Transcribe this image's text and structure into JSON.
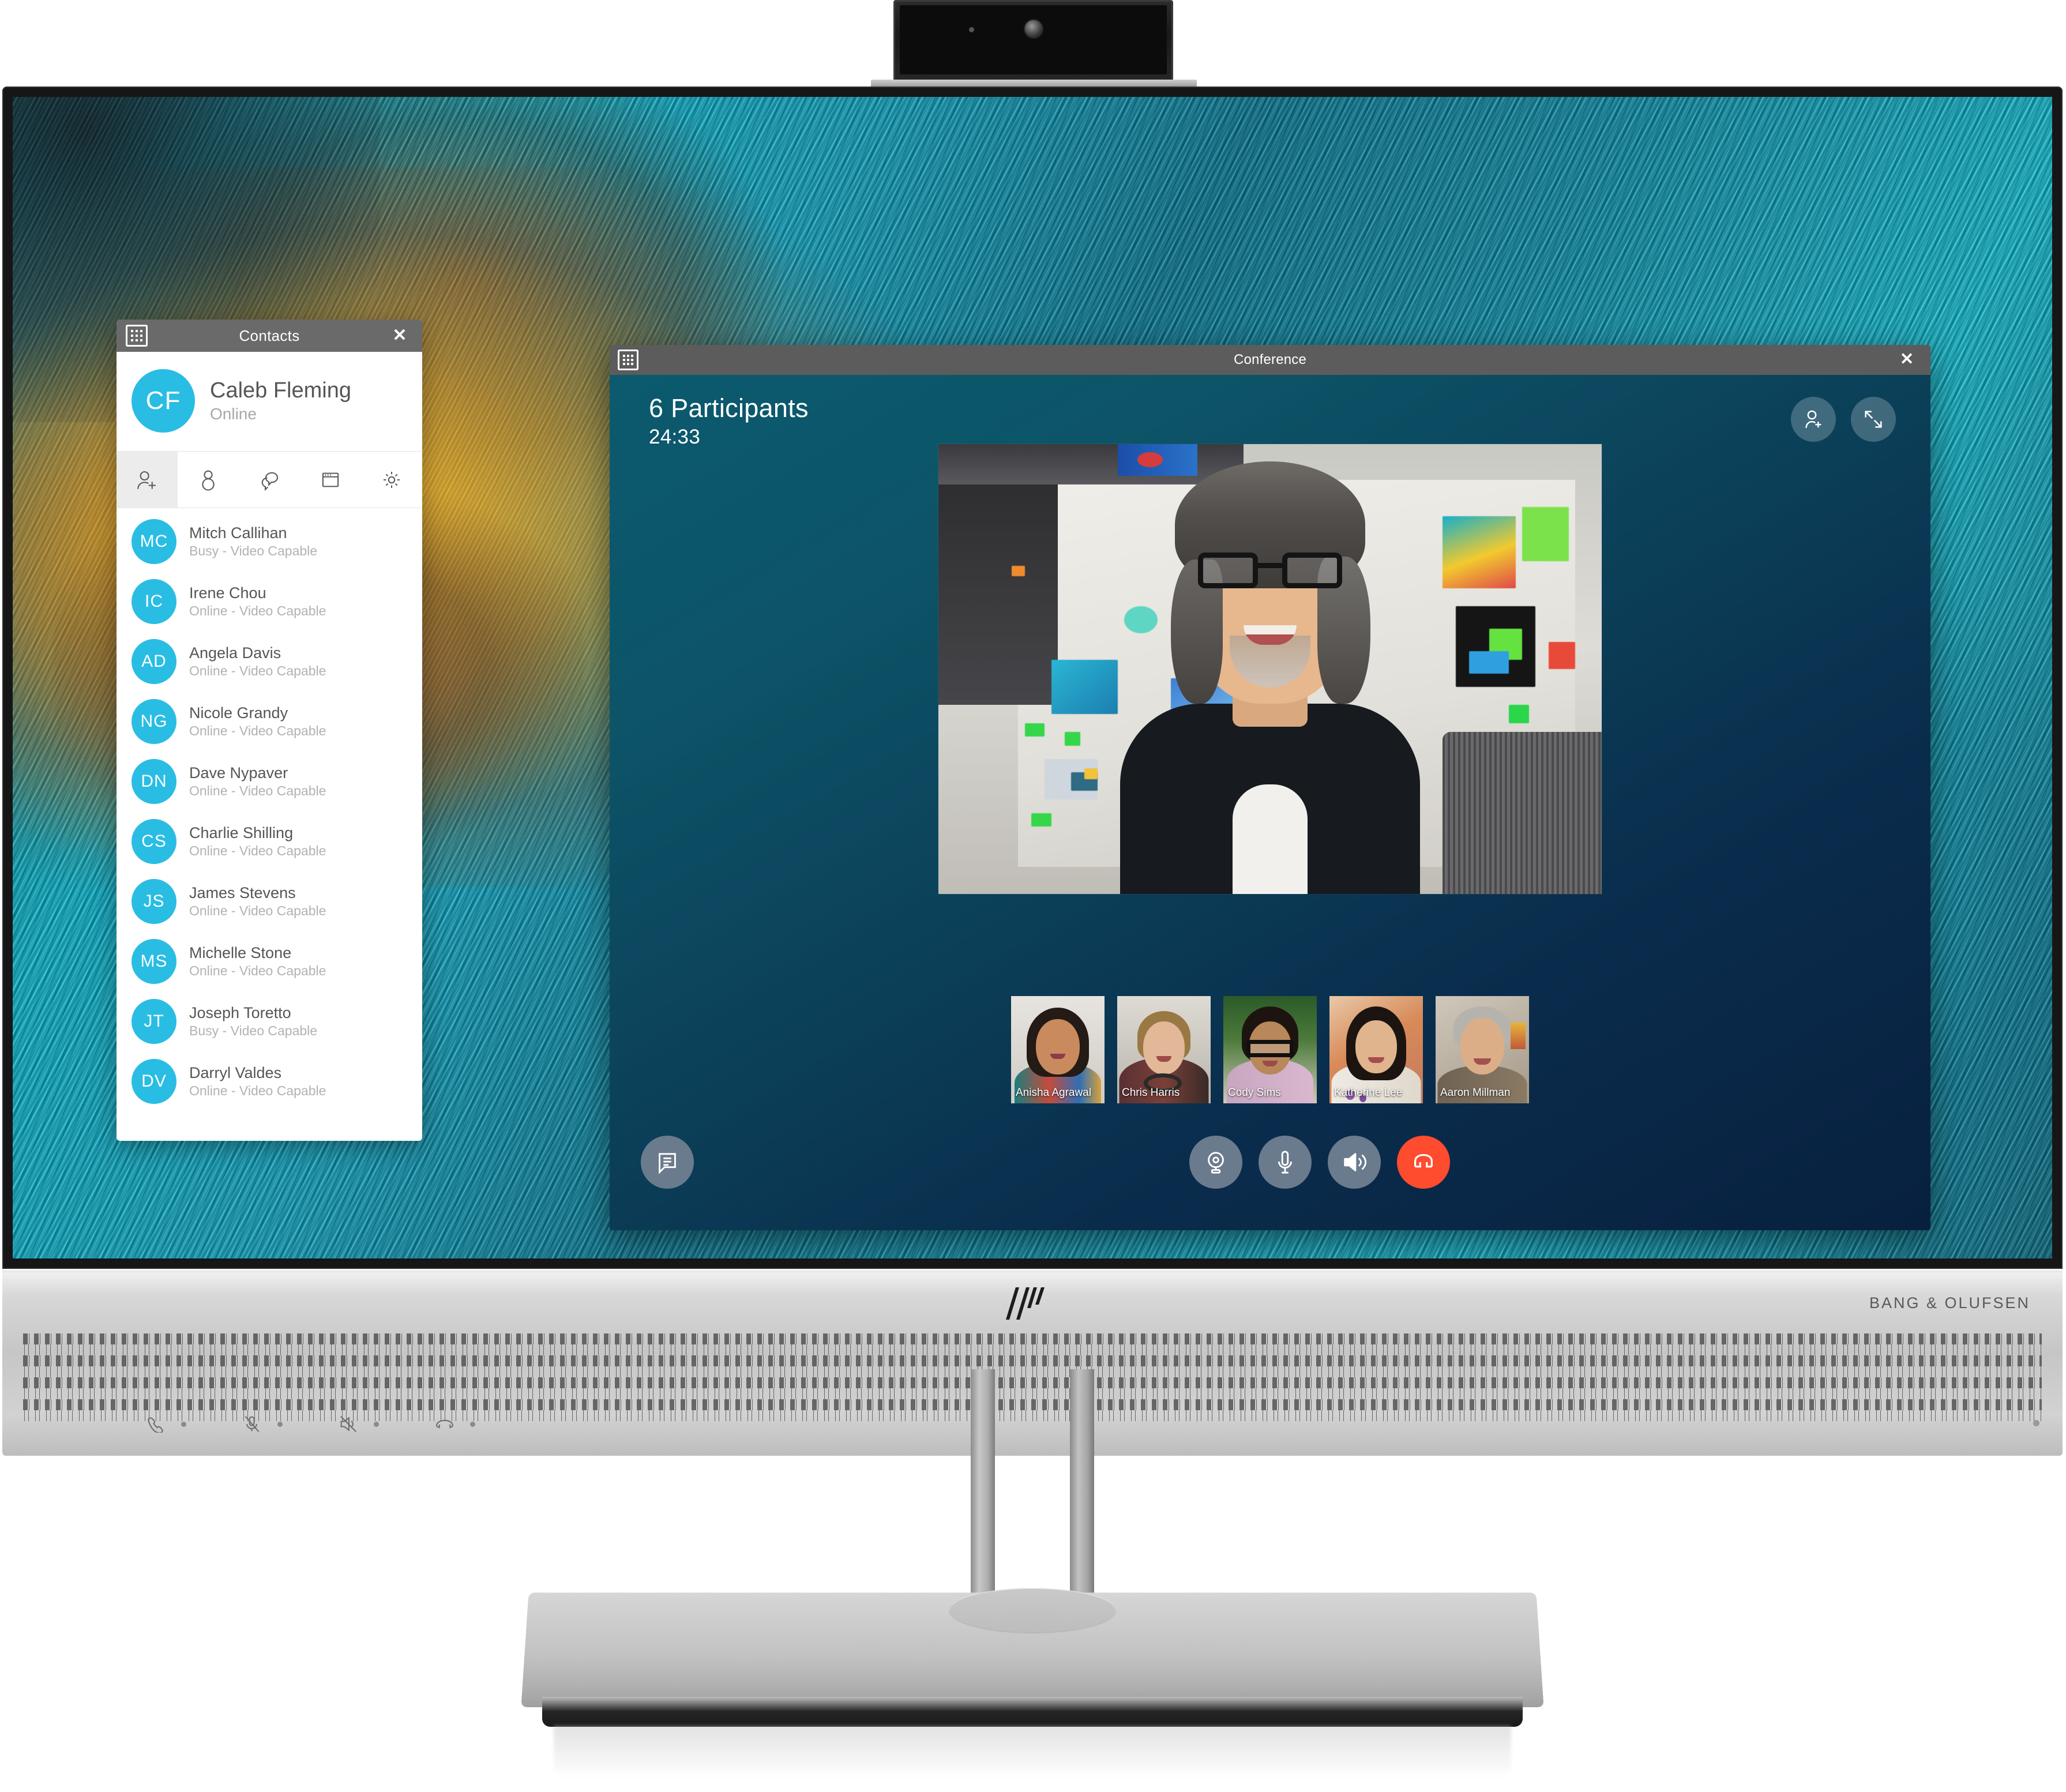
{
  "device": {
    "brand_logo": "hp-logo",
    "audio_brand": "BANG & OLUFSEN",
    "webcam": "pop-up-webcam",
    "bezel_controls": [
      {
        "name": "answer-call",
        "icon": "phone-handset-icon"
      },
      {
        "name": "mute-microphone",
        "icon": "mic-muted-icon"
      },
      {
        "name": "mute-speaker",
        "icon": "speaker-muted-icon"
      },
      {
        "name": "end-call",
        "icon": "phone-hangup-icon"
      }
    ]
  },
  "contacts_window": {
    "title": "Contacts",
    "app_icon": "app-grid-icon",
    "close_label": "✕",
    "profile": {
      "initials": "CF",
      "name": "Caleb Fleming",
      "status": "Online"
    },
    "tabs": [
      {
        "name": "add-contact",
        "icon": "person-add-icon",
        "active": true
      },
      {
        "name": "presence",
        "icon": "person-icon",
        "active": false
      },
      {
        "name": "chat",
        "icon": "chat-bubbles-icon",
        "active": false
      },
      {
        "name": "window",
        "icon": "window-icon",
        "active": false
      },
      {
        "name": "settings",
        "icon": "gear-icon",
        "active": false
      }
    ],
    "contacts": [
      {
        "initials": "MC",
        "name": "Mitch Callihan",
        "status": "Busy - Video Capable"
      },
      {
        "initials": "IC",
        "name": "Irene Chou",
        "status": "Online - Video Capable"
      },
      {
        "initials": "AD",
        "name": "Angela Davis",
        "status": "Online - Video Capable"
      },
      {
        "initials": "NG",
        "name": "Nicole Grandy",
        "status": "Online - Video Capable"
      },
      {
        "initials": "DN",
        "name": "Dave Nypaver",
        "status": "Online - Video Capable"
      },
      {
        "initials": "CS",
        "name": "Charlie Shilling",
        "status": "Online - Video Capable"
      },
      {
        "initials": "JS",
        "name": "James Stevens",
        "status": "Online - Video Capable"
      },
      {
        "initials": "MS",
        "name": "Michelle Stone",
        "status": "Online - Video Capable"
      },
      {
        "initials": "JT",
        "name": "Joseph Toretto",
        "status": "Busy - Video Capable"
      },
      {
        "initials": "DV",
        "name": "Darryl Valdes",
        "status": "Online - Video Capable"
      }
    ]
  },
  "conference_window": {
    "title": "Conference",
    "app_icon": "app-grid-icon",
    "close_label": "✕",
    "participants_label": "6 Participants",
    "timer": "24:33",
    "header_actions": [
      {
        "name": "add-participant",
        "icon": "person-add-icon"
      },
      {
        "name": "resize-window",
        "icon": "resize-arrows-icon"
      }
    ],
    "active_speaker": {
      "name": ""
    },
    "thumbnails": [
      {
        "name": "Anisha Agrawal"
      },
      {
        "name": "Chris Harris"
      },
      {
        "name": "Cody Sims"
      },
      {
        "name": "Katherine Lee"
      },
      {
        "name": "Aaron Millman"
      }
    ],
    "controls": [
      {
        "name": "chat",
        "icon": "chat-icon",
        "style": "neutral"
      },
      {
        "name": "camera",
        "icon": "webcam-icon",
        "style": "neutral"
      },
      {
        "name": "microphone",
        "icon": "microphone-icon",
        "style": "neutral"
      },
      {
        "name": "speaker",
        "icon": "speaker-icon",
        "style": "neutral"
      },
      {
        "name": "end-call",
        "icon": "phone-hangup-icon",
        "style": "danger"
      }
    ]
  },
  "colors": {
    "accent_blue": "#29bde4",
    "titlebar_gray": "#6a6a6a",
    "conference_bg_start": "#0b5a6e",
    "conference_bg_end": "#08203f",
    "control_neutral": "#6b7b8e",
    "end_call_red": "#ff4b2e"
  }
}
